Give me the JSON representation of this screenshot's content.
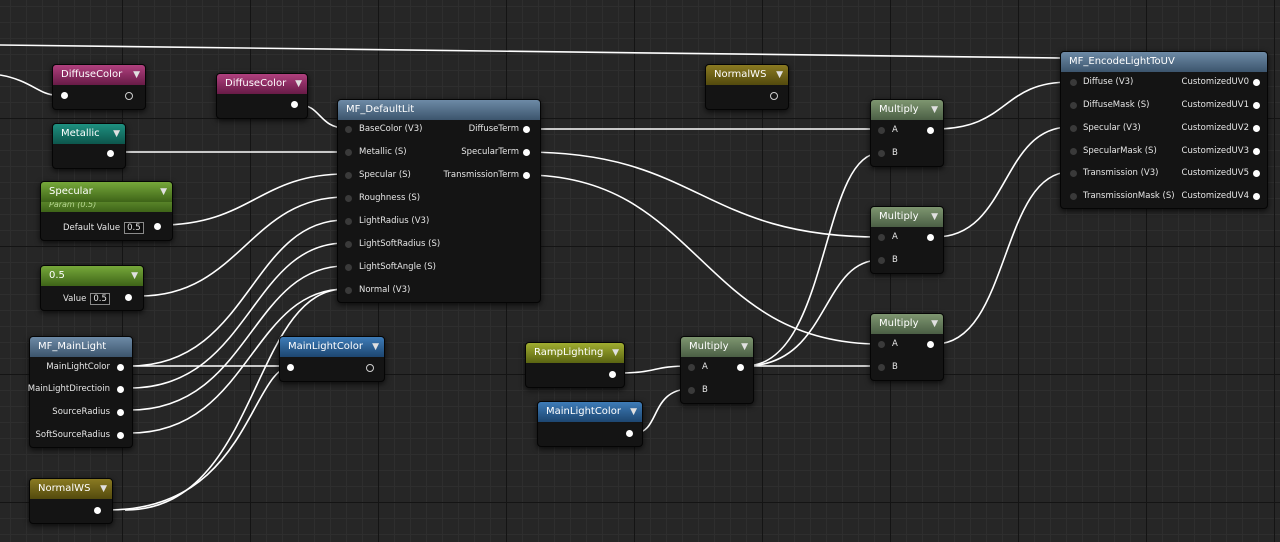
{
  "nodes": {
    "diffuse_color_a": {
      "title": "DiffuseColor"
    },
    "diffuse_color_b": {
      "title": "DiffuseColor"
    },
    "metallic": {
      "title": "Metallic"
    },
    "specular": {
      "title": "Specular",
      "subtitle": "Param (0.5)",
      "field_label": "Default Value",
      "field_value": "0.5"
    },
    "const_05": {
      "title": "0.5",
      "field_label": "Value",
      "field_value": "0.5"
    },
    "main_light": {
      "title": "MF_MainLight",
      "outputs": [
        "MainLightColor",
        "MainLightDirectioin",
        "SourceRadius",
        "SoftSourceRadius"
      ]
    },
    "normal_ws_bottom": {
      "title": "NormalWS"
    },
    "normal_ws_top": {
      "title": "NormalWS"
    },
    "main_light_color_a": {
      "title": "MainLightColor"
    },
    "main_light_color_b": {
      "title": "MainLightColor"
    },
    "ramp_lighting": {
      "title": "RampLighting"
    },
    "default_lit": {
      "title": "MF_DefaultLit",
      "inputs": [
        "BaseColor (V3)",
        "Metallic (S)",
        "Specular (S)",
        "Roughness (S)",
        "LightRadius (V3)",
        "LightSoftRadius (S)",
        "LightSoftAngle (S)",
        "Normal (V3)"
      ],
      "outputs": [
        "DiffuseTerm",
        "SpecularTerm",
        "TransmissionTerm"
      ]
    },
    "multiply_1": {
      "title": "Multiply",
      "inputs": [
        "A",
        "B"
      ]
    },
    "multiply_2": {
      "title": "Multiply",
      "inputs": [
        "A",
        "B"
      ]
    },
    "multiply_3": {
      "title": "Multiply",
      "inputs": [
        "A",
        "B"
      ]
    },
    "multiply_4": {
      "title": "Multiply",
      "inputs": [
        "A",
        "B"
      ]
    },
    "encode": {
      "title": "MF_EncodeLightToUV",
      "inputs": [
        "Diffuse (V3)",
        "DiffuseMask (S)",
        "Specular (V3)",
        "SpecularMask (S)",
        "Transmission (V3)",
        "TransmissionMask (S)"
      ],
      "outputs": [
        "CustomizedUV0",
        "CustomizedUV1",
        "CustomizedUV2",
        "CustomizedUV3",
        "CustomizedUV5",
        "CustomizedUV4"
      ]
    }
  },
  "icons": {
    "collapse": "chevron-down-icon",
    "pin": "pin-connector-icon"
  }
}
